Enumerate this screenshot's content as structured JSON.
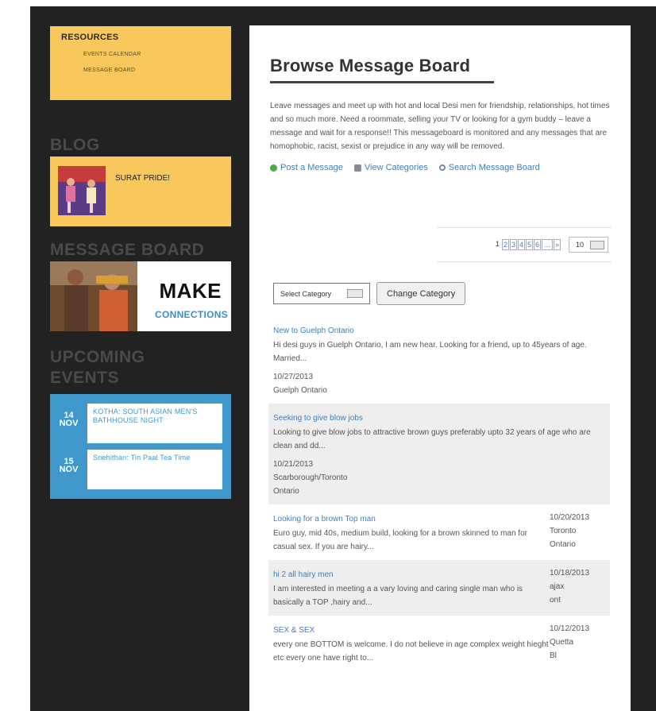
{
  "sidebar": {
    "resources": {
      "title": "RESOURCES",
      "links": [
        "EVENTS CALENDAR",
        "MESSAGE BOARD"
      ]
    },
    "blog": {
      "heading": "BLOG",
      "post": "SURAT PRIDE!"
    },
    "message_board": {
      "heading": "MESSAGE BOARD",
      "banner_title": "MAKE",
      "banner_sub": "CONNECTIONS"
    },
    "events": {
      "heading_1": "UPCOMING",
      "heading_2": "EVENTS",
      "items": [
        {
          "day": "14",
          "month": "NOV",
          "title": "KOTHA: SOUTH ASIAN MEN'S BATHHOUSE NIGHT"
        },
        {
          "day": "15",
          "month": "NOV",
          "title": "Snehithan: Tin Paal Tea Time"
        }
      ]
    }
  },
  "main": {
    "title": "Browse Message Board",
    "intro": "Leave messages and meet up with hot and local Desi men for friendship, relationships, hot times and so much more. Need a roommate, selling your TV or looking for a gym buddy – leave a message and wait for a response!! This messageboard is monitored and any messages that are homophobic, racist, sexist or prejudice in any way will be removed.",
    "actions": {
      "post": "Post a Message",
      "categories": "View Categories",
      "search": "Search Message Board"
    },
    "pager": {
      "pages": [
        "1",
        "2",
        "3",
        "4",
        "5",
        "6",
        "...",
        "»"
      ],
      "per_page": "10"
    },
    "category": {
      "select": "Select Category",
      "button": "Change Category"
    },
    "posts_top": [
      {
        "title": "New to Guelph Ontario",
        "body": "Hi desi guys in Guelph Ontario, I am new hear. Looking for a friend, up to 45years of age. Married...",
        "date": "10/27/2013",
        "loc1": "Guelph Ontario",
        "loc2": ""
      },
      {
        "title": "Seeking to give blow jobs",
        "body": "Looking to give blow jobs to attractive brown guys preferably upto 32 years of age who are clean and dd...",
        "date": "10/21/2013",
        "loc1": "Scarborough/Toronto",
        "loc2": "Ontario"
      }
    ],
    "posts_row": [
      {
        "title": "Looking for a brown Top man",
        "body": "Euro guy, mid 40s, medium build, looking for a brown skinned to man for casual sex. If you are hairy...",
        "date": "10/20/2013",
        "loc1": "Toronto",
        "loc2": "Ontario"
      },
      {
        "title": "hi 2 all hairy men",
        "body": "I am interested in meeting a a vary loving and caring single man who is basically a TOP ,hairy and...",
        "date": "10/18/2013",
        "loc1": "ajax",
        "loc2": "ont"
      },
      {
        "title": "SEX & SEX",
        "body": "every one BOTTOM is welcome. I do not believe in age complex weight hieght etc every one have right to...",
        "date": "10/12/2013",
        "loc1": "Quetta",
        "loc2": "Bl"
      }
    ]
  }
}
